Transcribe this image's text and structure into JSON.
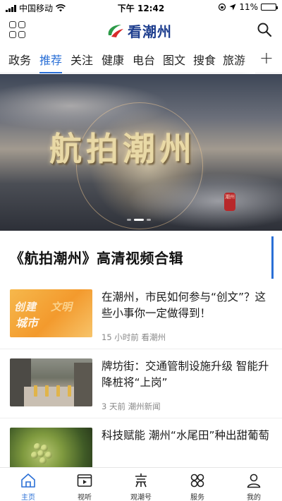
{
  "status_bar": {
    "carrier": "中国移动",
    "time": "下午 12:42",
    "battery": "11%",
    "battery_level": 0.11
  },
  "header": {
    "apps_icon": "grid-apps-icon",
    "logo_text": "看潮州",
    "search_icon": "search-icon"
  },
  "tabs": [
    {
      "label": "政务",
      "active": false
    },
    {
      "label": "推荐",
      "active": true
    },
    {
      "label": "关注",
      "active": false
    },
    {
      "label": "健康",
      "active": false
    },
    {
      "label": "电台",
      "active": false
    },
    {
      "label": "图文",
      "active": false
    },
    {
      "label": "搜食",
      "active": false
    },
    {
      "label": "旅游",
      "active": false
    }
  ],
  "tab_add": "+",
  "banner": {
    "title_art": "航拍潮州",
    "seal": "潮州",
    "active_slide": 1,
    "slide_count": 3
  },
  "section": {
    "title": "《航拍潮州》高清视频合辑"
  },
  "news": [
    {
      "headline": "在潮州，市民如何参与“创文”？这些小事你一定做得到！",
      "meta": "15 小时前 看潮州",
      "thumb_text": [
        "创建",
        "文明",
        "城市"
      ]
    },
    {
      "headline": "牌坊街：交通管制设施升级 智能升降桩将“上岗”",
      "meta": "3 天前 潮州新闻"
    },
    {
      "headline": "科技赋能 潮州“水尾田”种出甜葡萄",
      "meta": ""
    }
  ],
  "bottom_nav": [
    {
      "label": "主页",
      "icon": "home-icon",
      "active": true
    },
    {
      "label": "视听",
      "icon": "video-icon",
      "active": false
    },
    {
      "label": "观潮号",
      "icon": "observe-icon",
      "active": false
    },
    {
      "label": "服务",
      "icon": "services-icon",
      "active": false
    },
    {
      "label": "我的",
      "icon": "profile-icon",
      "active": false
    }
  ],
  "colors": {
    "accent": "#2a6fd6",
    "logo": "#1f3f8f",
    "battery_low": "#e33"
  }
}
